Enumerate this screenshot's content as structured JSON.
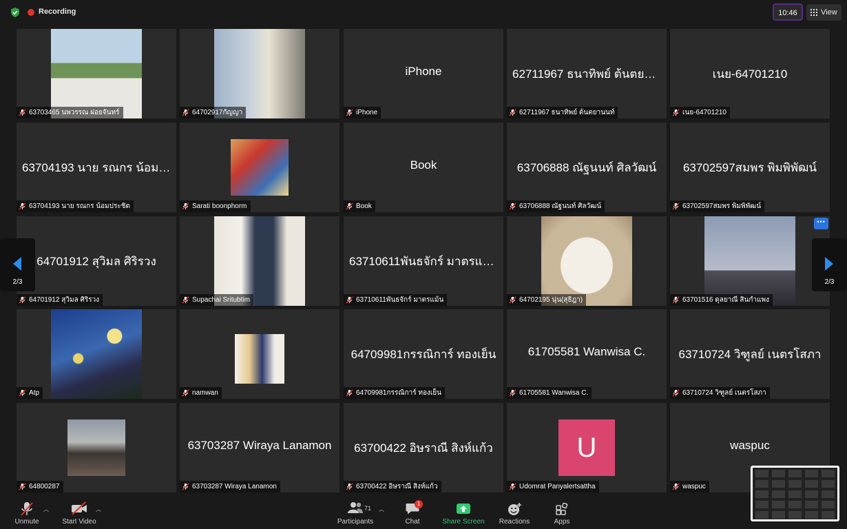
{
  "topbar": {
    "recording_label": "Recording",
    "time": "10:46",
    "view_label": "View"
  },
  "pager": {
    "left_page": "2/3",
    "right_page": "2/3"
  },
  "tiles": [
    {
      "big": "",
      "caption": "63703465 นพวรรณ  ฝอยจันทร์",
      "photo": "beach-photo"
    },
    {
      "big": "",
      "caption": "64702917กัญญา",
      "photo": "woman-photo"
    },
    {
      "big": "iPhone",
      "caption": "iPhone"
    },
    {
      "big": "62711967 ธนาทิพย์ ต้นตยานนท์",
      "caption": "62711967 ธนาทิพย์ ต้นตยานนท์"
    },
    {
      "big": "เนย-64701210",
      "caption": "เนย-64701210"
    },
    {
      "big": "63704193 นาย รณกร น้อมประชิด",
      "caption": "63704193 นาย รณกร น้อมประชิด"
    },
    {
      "big": "",
      "caption": "Sarati boonphorm",
      "photo": "anime-photo"
    },
    {
      "big": "Book",
      "caption": "Book"
    },
    {
      "big": "63706888 ณัฐนนท์ ศิลวัฒน์",
      "caption": "63706888 ณัฐนนท์ ศิลวัฒน์"
    },
    {
      "big": "63702597สมพร พิมพิพัฒน์",
      "caption": "63702597สมพร พิมพิพัฒน์"
    },
    {
      "big": "64701912 สุวิมล ศิริรวง",
      "caption": "64701912 สุวิมล ศิริรวง"
    },
    {
      "big": "",
      "caption": "Supachai Sritubtim",
      "photo": "man-photo"
    },
    {
      "big": "63710611พันธจักร์ มาตรแม้น",
      "caption": "63710611พันธจักร์ มาตรแม้น"
    },
    {
      "big": "",
      "caption": "64702195 นุ่น(สุธิฎา)",
      "photo": "cat-photo"
    },
    {
      "big": "",
      "caption": "63701516 ดุลยาณี สินกำแพง",
      "photo": "silhouette-photo"
    },
    {
      "big": "",
      "caption": "Atp",
      "photo": "starry-night-photo"
    },
    {
      "big": "",
      "caption": "namwan",
      "photo": "illustration-photo"
    },
    {
      "big": "64709981กรรณิการ์ ทองเย็น",
      "caption": "64709981กรรณิการ์ ทองเย็น"
    },
    {
      "big": "61705581 Wanwisa C.",
      "caption": "61705581 Wanwisa C."
    },
    {
      "big": "63710724 วิฑูลย์  เนตรโสภา",
      "caption": "63710724 วิฑูลย์  เนตรโสภา"
    },
    {
      "big": "",
      "caption": "64800287",
      "photo": "woman-outdoor-photo"
    },
    {
      "big": "63703287 Wiraya Lanamon",
      "caption": "63703287 Wiraya Lanamon"
    },
    {
      "big": "63700422 อิษราณี สิงห์แก้ว",
      "caption": "63700422 อิษราณี สิงห์แก้ว"
    },
    {
      "big": "",
      "caption": "Udomrat Panyalertsattha",
      "avatar_letter": "U",
      "avatar_color": "#d9456f"
    },
    {
      "big": "waspuc",
      "caption": "waspuc"
    }
  ],
  "toolbar": {
    "unmute": "Unmute",
    "start_video": "Start Video",
    "participants": "Participants",
    "participants_count": "71",
    "chat": "Chat",
    "chat_badge": "1",
    "share_screen": "Share Screen",
    "reactions": "Reactions",
    "apps": "Apps"
  },
  "colors": {
    "share_green": "#2ecc71",
    "badge_red": "#e0332a",
    "accent_purple": "#5a2a86"
  }
}
